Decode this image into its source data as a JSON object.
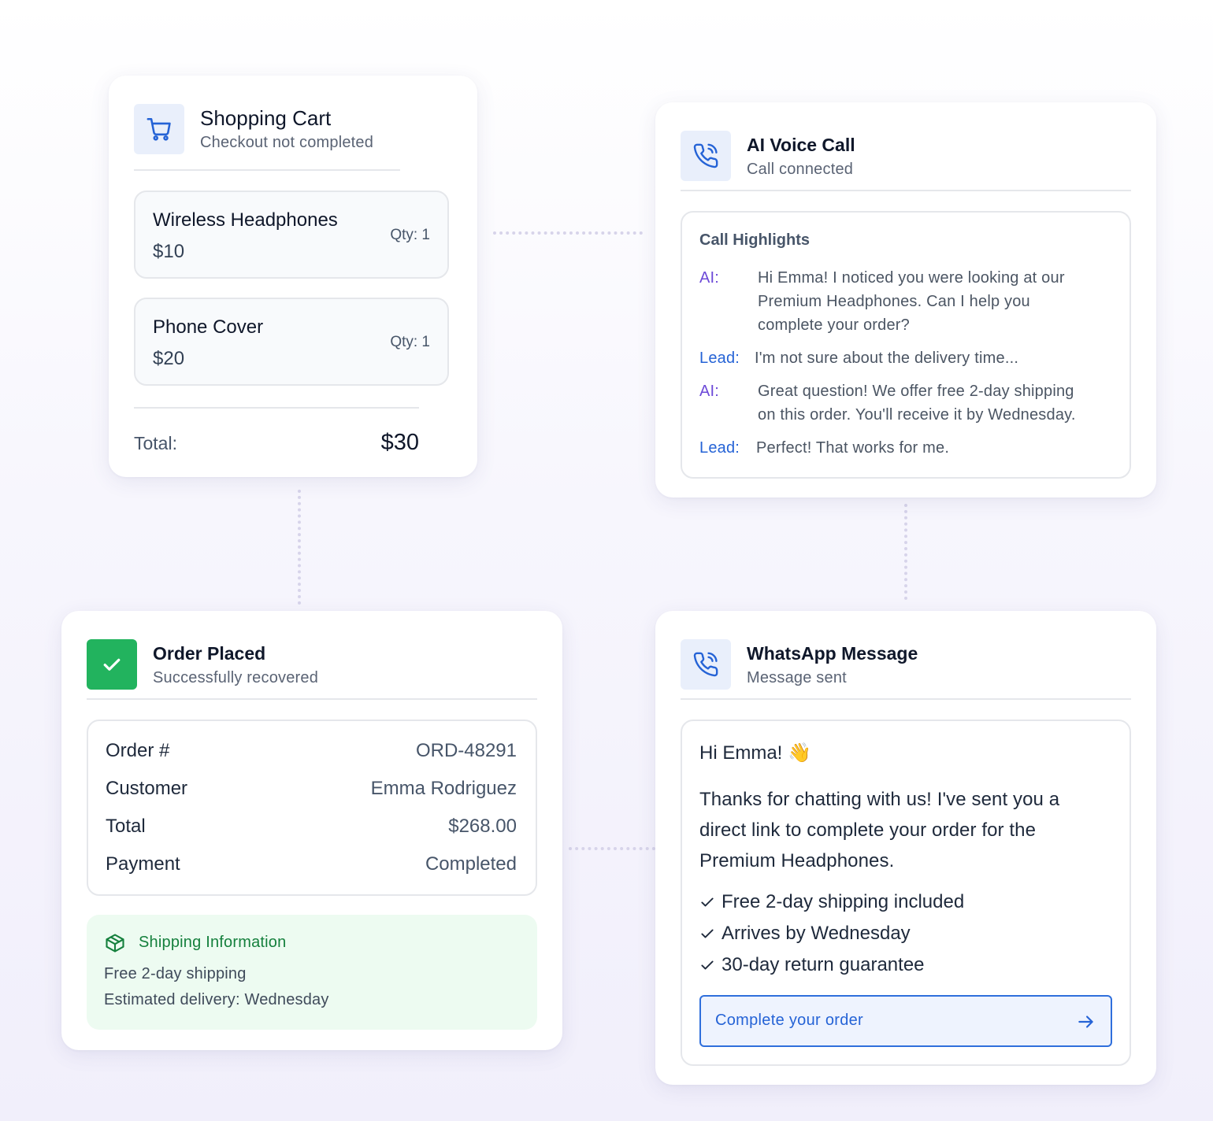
{
  "cart": {
    "title": "Shopping Cart",
    "subtitle": "Checkout not completed",
    "icon": "shopping-cart-icon",
    "items": [
      {
        "name": "Wireless Headphones",
        "price": "$10",
        "qty": "Qty: 1"
      },
      {
        "name": "Phone Cover",
        "price": "$20",
        "qty": "Qty: 1"
      }
    ],
    "total_label": "Total:",
    "total_value": "$30"
  },
  "call": {
    "title": "AI Voice Call",
    "subtitle": "Call connected",
    "icon": "phone-call-icon",
    "highlights_title": "Call Highlights",
    "messages": [
      {
        "speaker": "AI:",
        "lines": [
          "Hi Emma! I noticed you were looking at our",
          "Premium Headphones. Can I help you",
          "complete your order?"
        ]
      },
      {
        "speaker": "Lead:",
        "lines": [
          "I'm not sure about the delivery time..."
        ]
      },
      {
        "speaker": "AI:",
        "lines": [
          "Great question! We offer free 2-day shipping",
          "on this order. You'll receive it by Wednesday."
        ]
      },
      {
        "speaker": "Lead:",
        "lines": [
          "Perfect! That works for me."
        ]
      }
    ]
  },
  "order": {
    "title": "Order Placed",
    "subtitle": "Successfully recovered",
    "icon": "check-icon",
    "rows": [
      {
        "label": "Order #",
        "value": "ORD-48291"
      },
      {
        "label": "Customer",
        "value": "Emma Rodriguez"
      },
      {
        "label": "Total",
        "value": "$268.00"
      },
      {
        "label": "Payment",
        "value": "Completed"
      }
    ],
    "shipping": {
      "title": "Shipping Information",
      "icon": "package-icon",
      "line1": "Free 2-day shipping",
      "line2": "Estimated delivery: Wednesday"
    }
  },
  "whatsapp": {
    "title": "WhatsApp Message",
    "subtitle": "Message sent",
    "icon": "phone-call-icon",
    "greeting": "Hi Emma! 👋",
    "body_lines": [
      "Thanks for chatting with us! I've sent you a",
      "direct link to complete your order for the",
      "Premium Headphones."
    ],
    "checks": [
      "Free 2-day shipping included",
      "Arrives by Wednesday",
      "30-day return guarantee"
    ],
    "cta_label": "Complete your order",
    "cta_icon": "arrow-right-icon"
  },
  "colors": {
    "accent_blue": "#2563d6",
    "ai_purple": "#6d4ad8",
    "success_green": "#22b35e",
    "icon_bg": "#e9effb"
  }
}
